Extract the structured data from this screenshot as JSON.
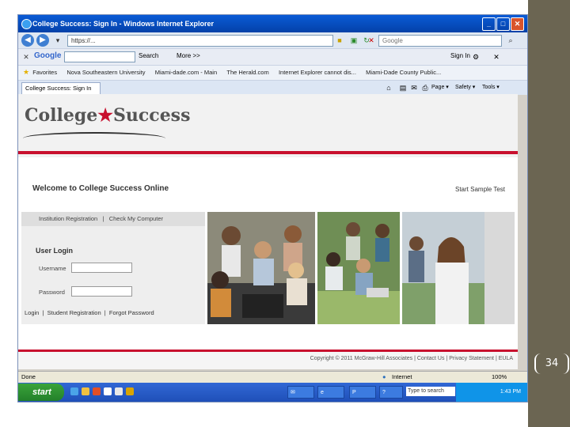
{
  "window": {
    "title": "College Success: Sign In - Windows Internet Explorer",
    "minimize": "_",
    "maximize": "□",
    "close": "✕"
  },
  "address_bar": {
    "url": "https://...",
    "search_placeholder": "Google"
  },
  "google_toolbar": {
    "brand": "Google",
    "search_label": "Search",
    "more_label": "More >>",
    "signin_label": "Sign In"
  },
  "favorites_bar": {
    "items": [
      "Favorites",
      "Nova Southeastern University",
      "Miami-dade.com - Main",
      "The Herald.com",
      "Internet Explorer cannot dis...",
      "Miami-Dade County Public..."
    ]
  },
  "command_bar": {
    "page_label": "Page ▾",
    "safety_label": "Safety ▾",
    "tools_label": "Tools ▾"
  },
  "tab": {
    "label": "College Success: Sign In"
  },
  "site": {
    "logo_left": "College",
    "logo_right": "Success",
    "welcome": "Welcome to College Success Online",
    "start_sample_test": "Start Sample Test",
    "institution_registration": "Institution Registration",
    "separator": "|",
    "check_my_computer": "Check My Computer",
    "user_login_title": "User Login",
    "username_label": "Username",
    "password_label": "Password",
    "login_link": "Login",
    "student_registration": "Student Registration",
    "forgot_password": "Forgot Password",
    "footer": "Copyright © 2011 McGraw-Hill Associates | Contact Us | Privacy Statement | EULA"
  },
  "status_bar": {
    "status": "Done",
    "zone": "Internet",
    "zoom": "100%"
  },
  "taskbar": {
    "start": "start",
    "input_placeholder": "Type to search",
    "clock": "1:43 PM"
  },
  "slide": {
    "page_number": "34"
  }
}
